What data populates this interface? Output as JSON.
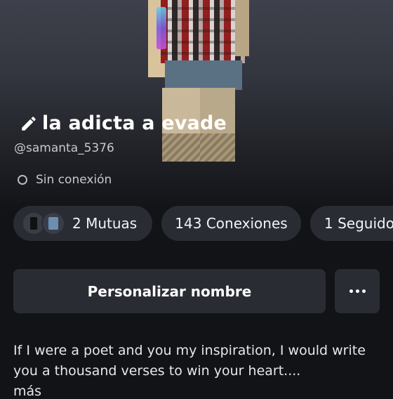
{
  "profile": {
    "display_name": "la adicta a evade",
    "username": "@samanta_5376",
    "status": "Sin conexión"
  },
  "stats": {
    "mutuals": "2 Mutuas",
    "connections": "143 Conexiones",
    "followers": "1 Seguido"
  },
  "actions": {
    "customize_label": "Personalizar nombre"
  },
  "bio": {
    "text": "If I were a poet and you my inspiration, I would write you a thousand verses to win your heart....",
    "more": "más"
  },
  "icons": {
    "edit": "pencil-icon",
    "status": "offline-status-icon",
    "more": "more-options-icon"
  },
  "colors": {
    "background": "#121317",
    "surface": "#2a2c33",
    "text": "#f2f3f5",
    "muted": "#c7c9cf"
  }
}
